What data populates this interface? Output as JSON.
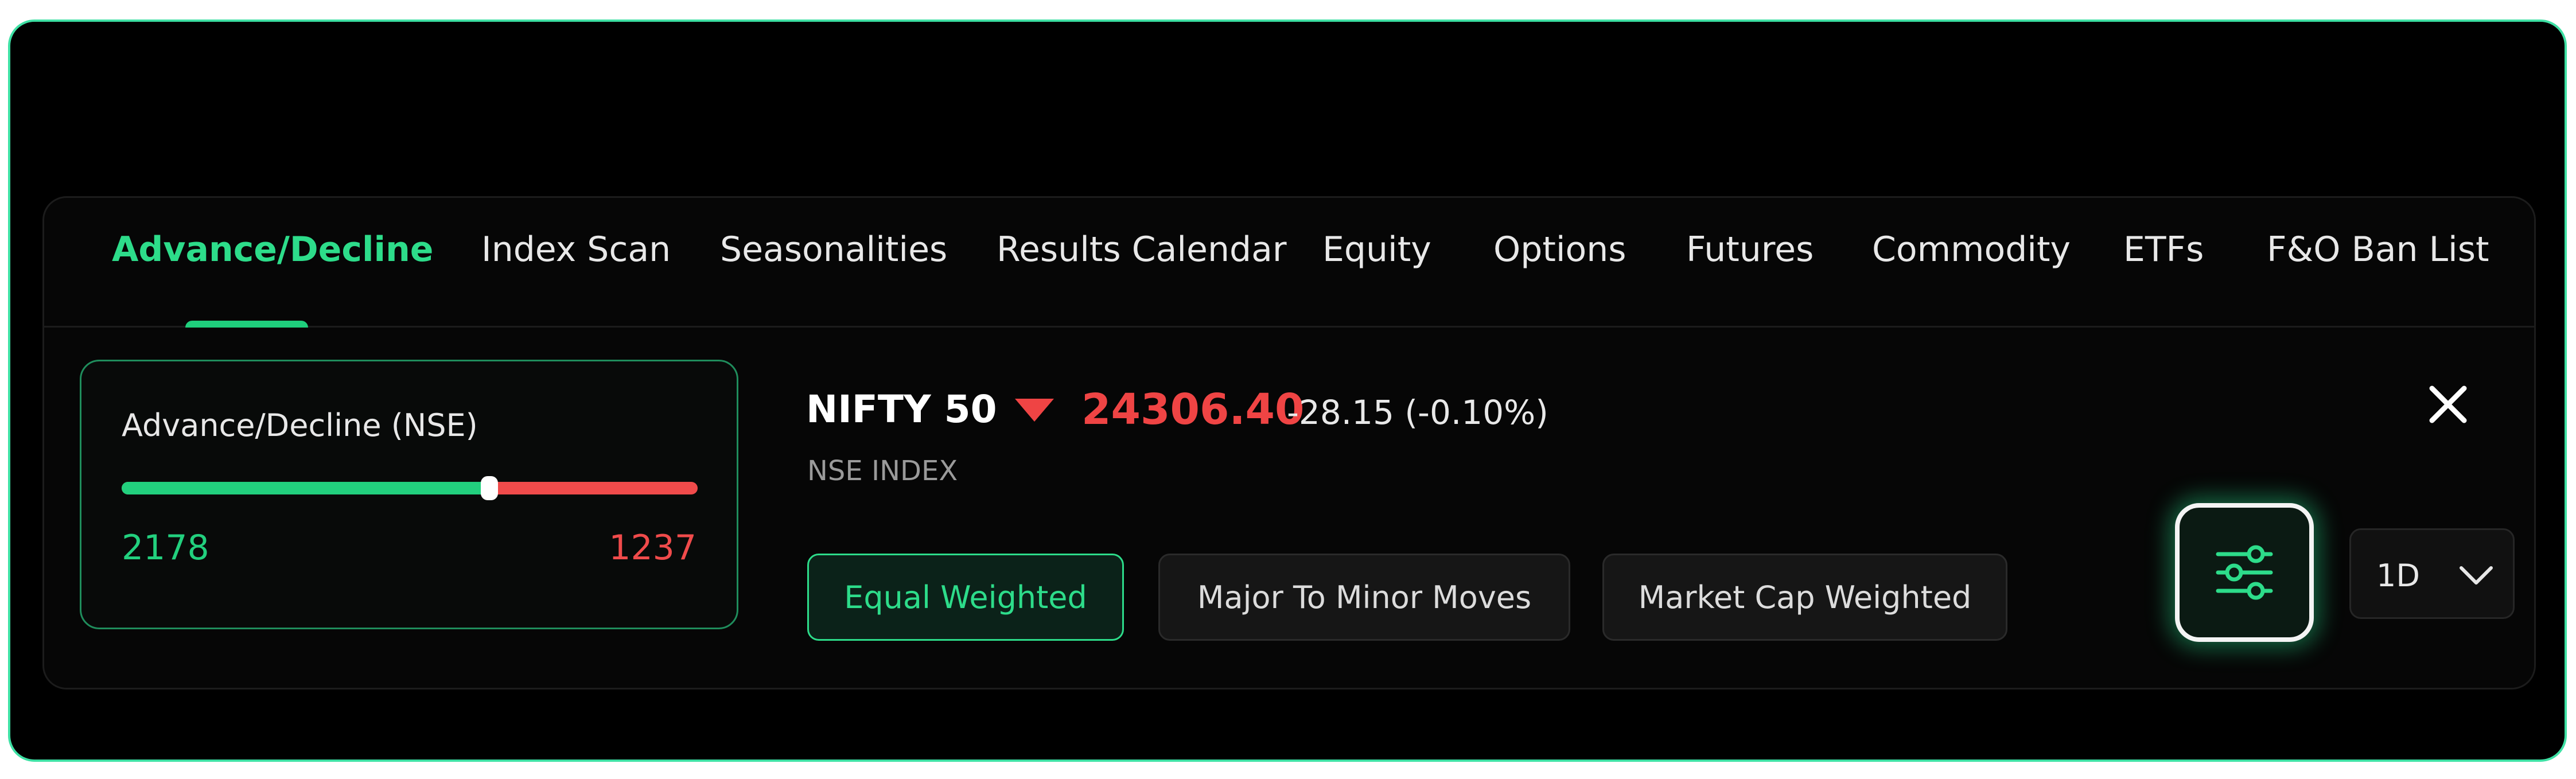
{
  "tabs": [
    {
      "label": "Advance/Decline",
      "active": true
    },
    {
      "label": "Index Scan",
      "active": false
    },
    {
      "label": "Seasonalities",
      "active": false
    },
    {
      "label": "Results Calendar",
      "active": false
    },
    {
      "label": "Equity",
      "active": false
    },
    {
      "label": "Options",
      "active": false
    },
    {
      "label": "Futures",
      "active": false
    },
    {
      "label": "Commodity",
      "active": false
    },
    {
      "label": "ETFs",
      "active": false
    },
    {
      "label": "F&O Ban List",
      "active": false
    }
  ],
  "advance_decline": {
    "title": "Advance/Decline (NSE)",
    "advances": "2178",
    "declines": "1237",
    "advance_fraction": 0.638
  },
  "index": {
    "name": "NIFTY 50",
    "price": "24306.40",
    "change": "-28.15 (-0.10%)",
    "subtitle": "NSE INDEX",
    "trend": "down"
  },
  "weighting": {
    "options": [
      "Equal Weighted",
      "Major To Minor Moves",
      "Market Cap Weighted"
    ],
    "selected": "Equal Weighted"
  },
  "timeframe": {
    "selected": "1D"
  },
  "icons": {
    "close": "close-icon",
    "filter": "sliders-icon",
    "dropdown": "chevron-down-icon",
    "trend": "triangle-down-icon"
  },
  "colors": {
    "accent": "#2ddc8a",
    "negative": "#ef4444",
    "frame_border": "#3ee0a4"
  }
}
